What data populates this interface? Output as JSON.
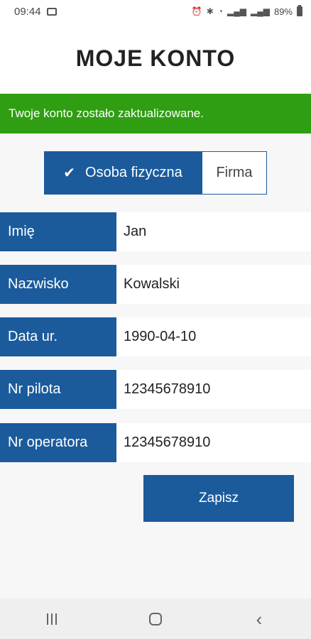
{
  "statusbar": {
    "time": "09:44",
    "battery": "89%"
  },
  "header": {
    "title": "MOJE KONTO"
  },
  "banner": {
    "message": "Twoje konto zostało zaktualizowane."
  },
  "account_type": {
    "options": [
      {
        "label": "Osoba fizyczna",
        "selected": true
      },
      {
        "label": "Firma",
        "selected": false
      }
    ]
  },
  "form": {
    "rows": [
      {
        "label": "Imię",
        "value": "Jan"
      },
      {
        "label": "Nazwisko",
        "value": "Kowalski"
      },
      {
        "label": "Data ur.",
        "value": "1990-04-10"
      },
      {
        "label": "Nr pilota",
        "value": "12345678910"
      },
      {
        "label": "Nr operatora",
        "value": "12345678910"
      }
    ]
  },
  "actions": {
    "save_label": "Zapisz"
  },
  "colors": {
    "primary": "#1b5b9c",
    "success": "#2f9e12"
  }
}
